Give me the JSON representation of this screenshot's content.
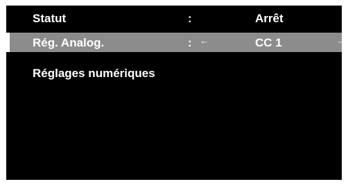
{
  "menu": {
    "rows": [
      {
        "label": "Statut",
        "separator": ":",
        "value": "Arrêt"
      },
      {
        "label": "Rég. Analog.",
        "separator": ":",
        "value": "CC 1",
        "left_arrow": "←",
        "right_arrow": "→",
        "selected": true
      },
      {
        "label": "Réglages numériques"
      }
    ]
  },
  "colors": {
    "background": "#000000",
    "highlight": "#8c8c8c",
    "text": "#ffffff"
  },
  "icons": {
    "left_arrow": "left-arrow-icon",
    "right_arrow": "right-arrow-icon"
  }
}
